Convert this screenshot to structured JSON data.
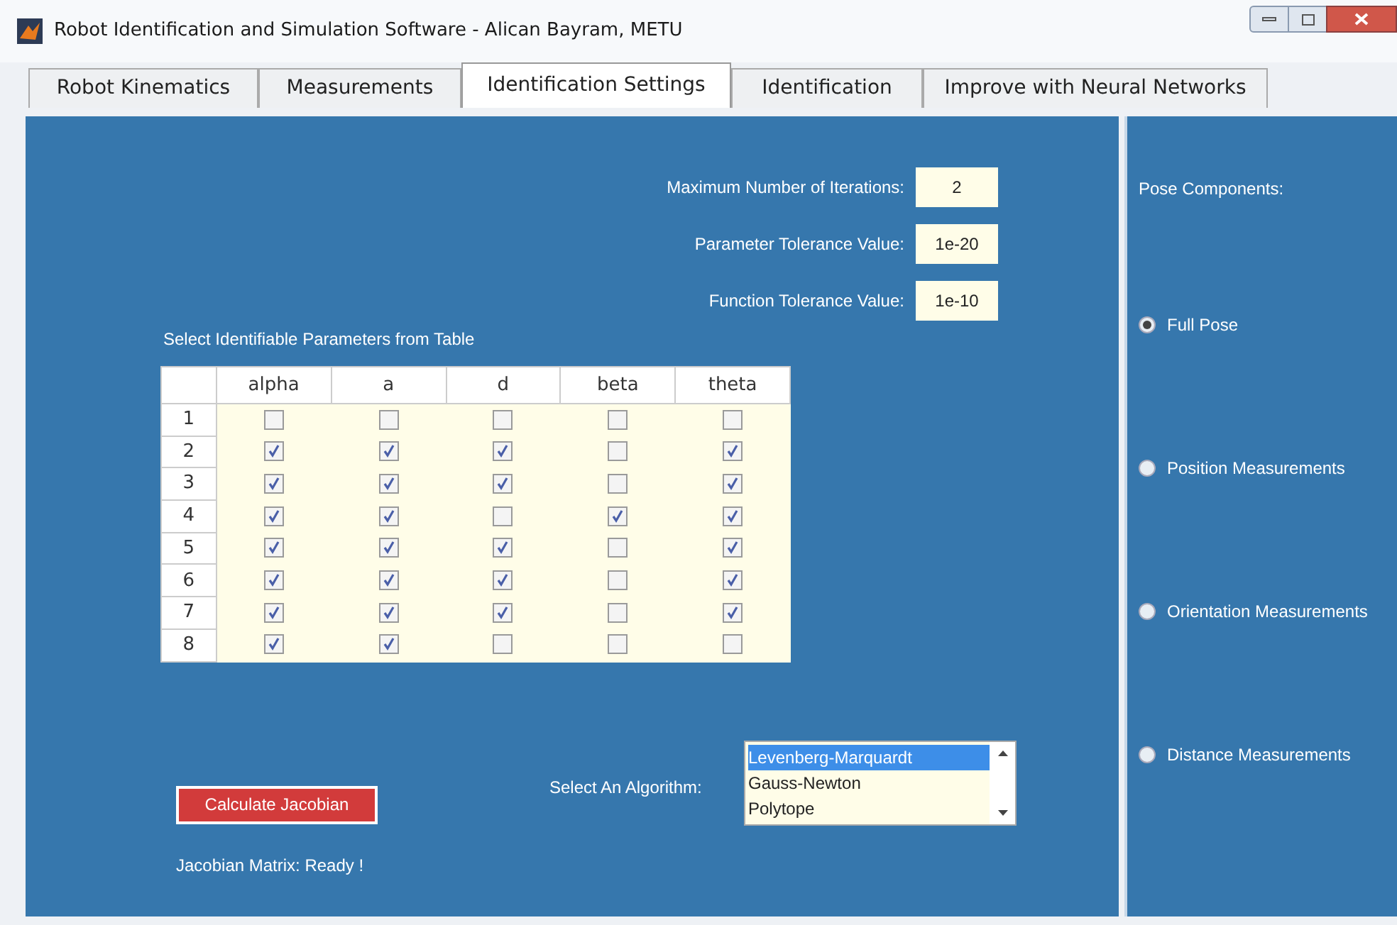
{
  "window": {
    "title": "Robot Identification and Simulation Software - Alican Bayram, METU"
  },
  "tabs": [
    {
      "label": "Robot Kinematics",
      "selected": false
    },
    {
      "label": "Measurements",
      "selected": false
    },
    {
      "label": "Identification Settings",
      "selected": true
    },
    {
      "label": "Identification",
      "selected": false
    },
    {
      "label": "Improve with Neural Networks",
      "selected": false
    }
  ],
  "settings": [
    {
      "label": "Maximum Number of Iterations:",
      "value": "2"
    },
    {
      "label": "Parameter Tolerance Value:",
      "value": "1e-20"
    },
    {
      "label": "Function Tolerance Value:",
      "value": "1e-10"
    }
  ],
  "table": {
    "caption": "Select Identifiable Parameters from Table",
    "columns": [
      "alpha",
      "a",
      "d",
      "beta",
      "theta"
    ],
    "rows": [
      {
        "label": "1",
        "checked": [
          false,
          false,
          false,
          false,
          false
        ]
      },
      {
        "label": "2",
        "checked": [
          true,
          true,
          true,
          false,
          true
        ]
      },
      {
        "label": "3",
        "checked": [
          true,
          true,
          true,
          false,
          true
        ]
      },
      {
        "label": "4",
        "checked": [
          true,
          true,
          false,
          true,
          true
        ]
      },
      {
        "label": "5",
        "checked": [
          true,
          true,
          true,
          false,
          true
        ]
      },
      {
        "label": "6",
        "checked": [
          true,
          true,
          true,
          false,
          true
        ]
      },
      {
        "label": "7",
        "checked": [
          true,
          true,
          true,
          false,
          true
        ]
      },
      {
        "label": "8",
        "checked": [
          true,
          true,
          false,
          false,
          false
        ]
      }
    ]
  },
  "calculate_button": "Calculate Jacobian",
  "jacobian_status": "Jacobian Matrix: Ready !",
  "algorithm": {
    "label": "Select An Algorithm:",
    "options": [
      {
        "label": "Levenberg-Marquardt",
        "selected": true
      },
      {
        "label": "Gauss-Newton",
        "selected": false
      },
      {
        "label": "Polytope",
        "selected": false
      }
    ]
  },
  "pose": {
    "title": "Pose Components:",
    "options": [
      {
        "label": "Full Pose",
        "selected": true
      },
      {
        "label": "Position Measurements",
        "selected": false
      },
      {
        "label": "Orientation Measurements",
        "selected": false
      },
      {
        "label": "Distance Measurements",
        "selected": false
      }
    ]
  }
}
